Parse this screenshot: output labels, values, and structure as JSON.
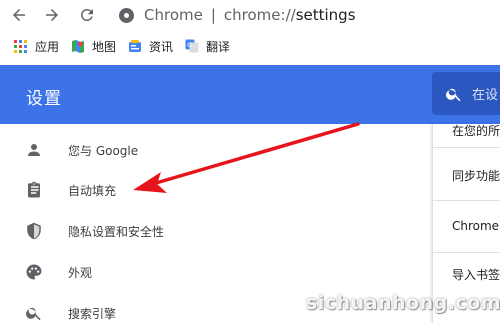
{
  "browser": {
    "origin_label": "Chrome",
    "url_scheme": "chrome://",
    "url_path": "settings"
  },
  "bookmarks": [
    {
      "label": "应用",
      "icon": "apps-grid-icon"
    },
    {
      "label": "地图",
      "icon": "maps-icon"
    },
    {
      "label": "资讯",
      "icon": "news-icon"
    },
    {
      "label": "翻译",
      "icon": "translate-icon"
    }
  ],
  "header": {
    "title": "设置",
    "search_placeholder": "在设"
  },
  "menu": {
    "items": [
      {
        "label": "您与 Google",
        "icon": "person-icon"
      },
      {
        "label": "自动填充",
        "icon": "clipboard-icon"
      },
      {
        "label": "隐私设置和安全性",
        "icon": "shield-icon"
      },
      {
        "label": "外观",
        "icon": "palette-icon"
      },
      {
        "label": "搜索引擎",
        "icon": "search-icon"
      }
    ]
  },
  "content": {
    "rows": [
      "在您的所",
      "同步功能",
      "Chrome",
      "导入书签"
    ]
  },
  "watermark": "sichuanhong.com",
  "colors": {
    "header_blue": "#3c73e8",
    "annotation_red": "#e8141c"
  }
}
